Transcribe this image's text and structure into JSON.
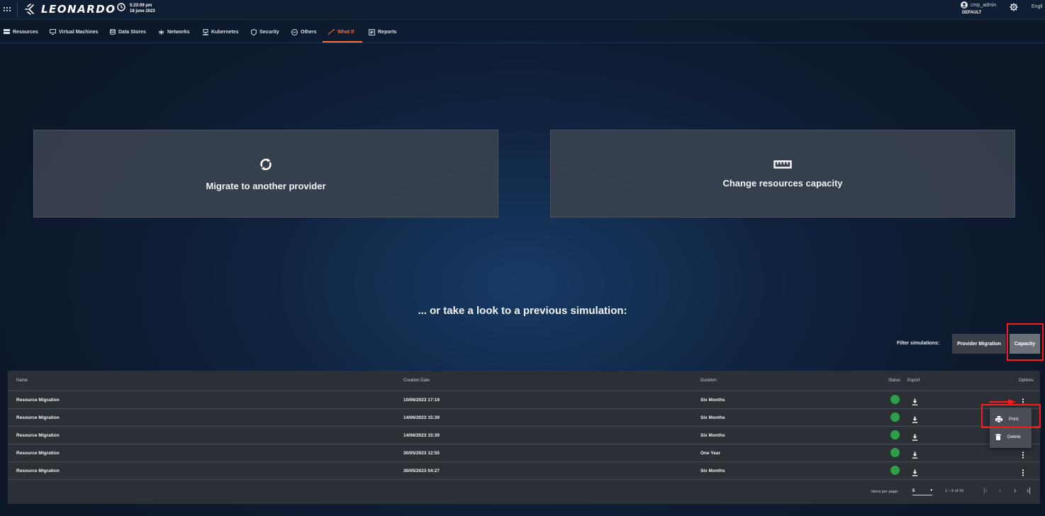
{
  "header": {
    "brand": "LEONARDO",
    "time": "5:23:09 pm",
    "date": "18 june 2023",
    "user": "cmp_admin",
    "role": "DEFAULT",
    "language": "Engli"
  },
  "nav": {
    "items": [
      {
        "label": "Resources",
        "icon": "server-icon"
      },
      {
        "label": "Virtual Machines",
        "icon": "monitor-icon"
      },
      {
        "label": "Data Stores",
        "icon": "database-icon"
      },
      {
        "label": "Networks",
        "icon": "network-icon"
      },
      {
        "label": "Kubernetes",
        "icon": "kubernetes-icon"
      },
      {
        "label": "Security",
        "icon": "shield-icon"
      },
      {
        "label": "Others",
        "icon": "others-icon"
      },
      {
        "label": "What If",
        "icon": "what-if-icon",
        "active": true
      },
      {
        "label": "Reports",
        "icon": "report-icon"
      }
    ]
  },
  "cards": {
    "migrate": {
      "title": "Migrate to another provider",
      "icon": "sync-icon"
    },
    "capacity": {
      "title": "Change resources capacity",
      "icon": "ruler-icon"
    }
  },
  "previous": {
    "heading": "... or take a look to a previous simulation:"
  },
  "filter": {
    "label": "Filter simulations:",
    "provider_migration": "Provider Migration",
    "capacity": "Capacity",
    "selected": "Capacity"
  },
  "table": {
    "headers": {
      "name": "Name",
      "creation_date": "Creation Date",
      "duration": "Duration",
      "status": "Status",
      "export": "Export",
      "options": "Options"
    },
    "rows": [
      {
        "name": "Resource Migration",
        "date": "10/06/2023 17:19",
        "duration": "Six Months",
        "status": "green"
      },
      {
        "name": "Resource Migration",
        "date": "14/06/2023 15:39",
        "duration": "Six Months",
        "status": "green"
      },
      {
        "name": "Resource Migration",
        "date": "14/06/2023 15:39",
        "duration": "Six Months",
        "status": "green"
      },
      {
        "name": "Resource Migration",
        "date": "30/05/2023 12:55",
        "duration": "One Year",
        "status": "green"
      },
      {
        "name": "Resource Migration",
        "date": "30/05/2023 04:27",
        "duration": "Six Months",
        "status": "green"
      }
    ],
    "paginator": {
      "label": "Items per page:",
      "page_size": "5",
      "range": "1 – 5 of 10"
    }
  },
  "context_menu": {
    "print": "Print",
    "delete": "Delete"
  },
  "colors": {
    "accent": "#ff6d3a",
    "status_ok": "#2f9e4b",
    "highlight": "#ff1a1a"
  }
}
